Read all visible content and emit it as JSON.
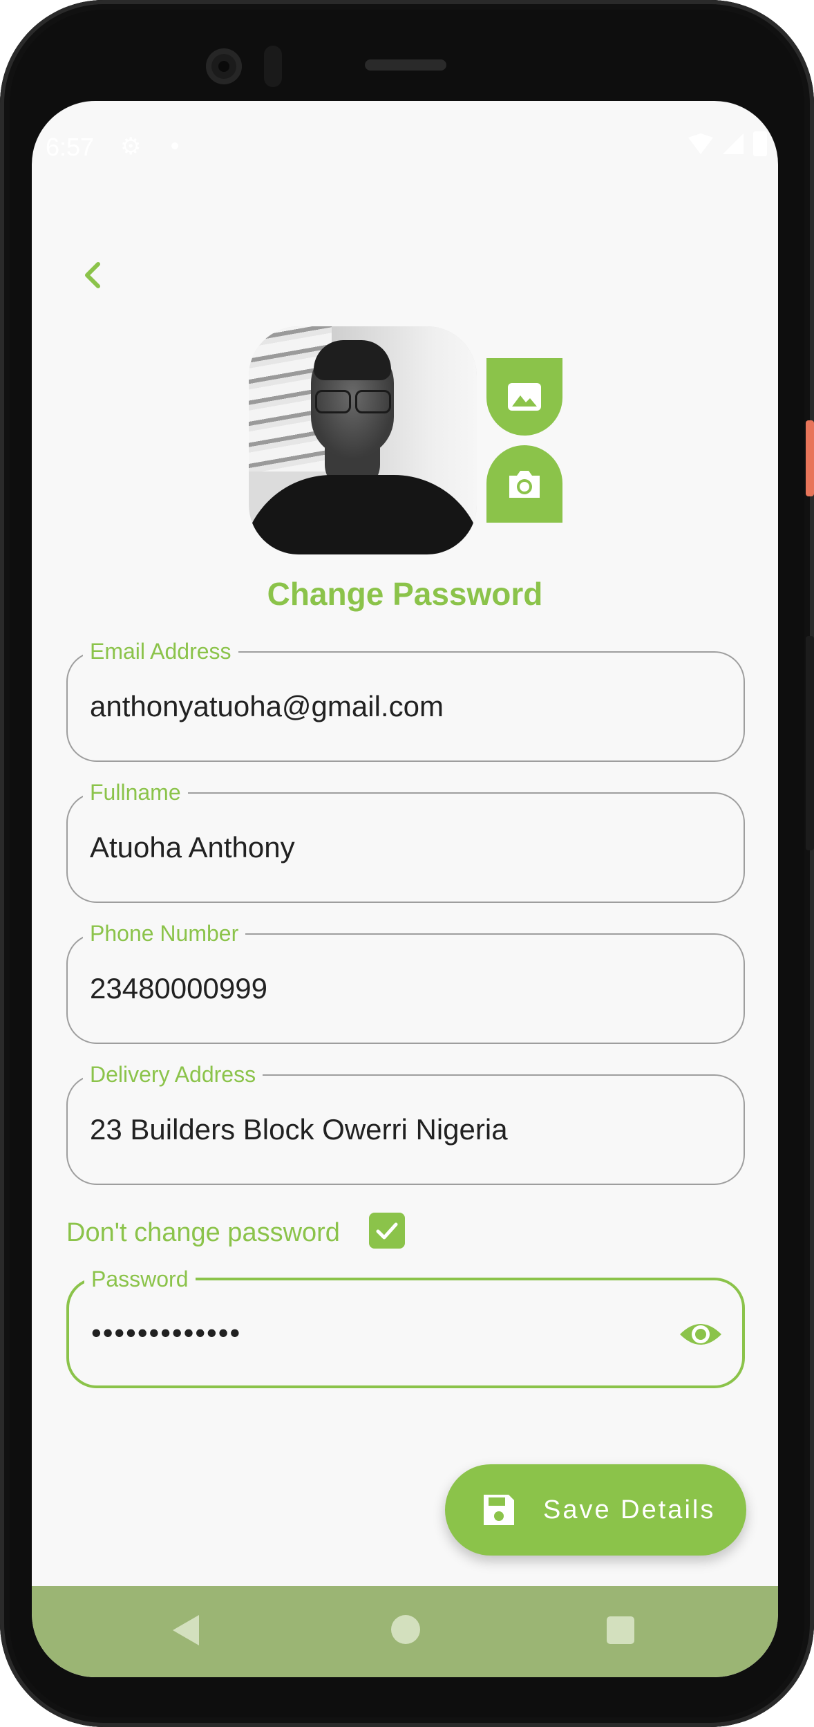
{
  "status_bar": {
    "time": "6:57",
    "gear": "⚙"
  },
  "header": {
    "back_icon": "chevron-left-icon"
  },
  "profile": {
    "gallery_icon": "image-icon",
    "camera_icon": "camera-icon"
  },
  "page_title": "Change Password",
  "form": {
    "email": {
      "label": "Email Address",
      "value": "anthonyatuoha@gmail.com"
    },
    "fullname": {
      "label": "Fullname",
      "value": "Atuoha Anthony"
    },
    "phone": {
      "label": "Phone Number",
      "value": "23480000999"
    },
    "address": {
      "label": "Delivery Address",
      "value": "23 Builders Block Owerri Nigeria"
    },
    "dont_change_password": {
      "label": "Don't change password",
      "checked": true
    },
    "password": {
      "label": "Password",
      "value": "•••••••••••••",
      "toggle_icon": "eye-icon"
    }
  },
  "save_button": {
    "label": "Save Details",
    "icon": "save-icon"
  },
  "colors": {
    "accent": "#8bc34a",
    "nav_bar": "#9bb574",
    "background": "#f8f8f8"
  }
}
